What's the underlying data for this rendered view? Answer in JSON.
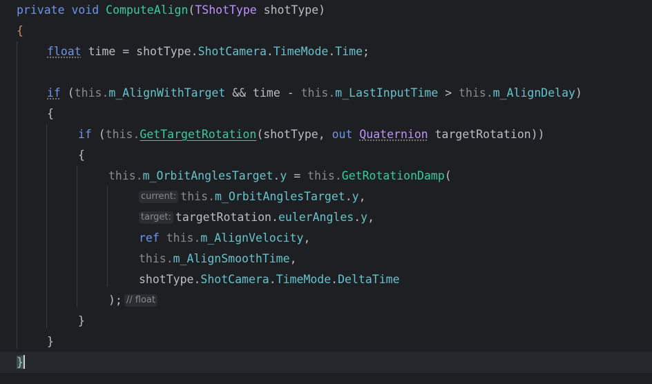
{
  "code": {
    "l1": {
      "kw1": "private",
      "kw2": "void",
      "name": "ComputeAlign",
      "p1": "(",
      "type": "TShotType",
      "p2": " shotType)"
    },
    "l2": {
      "brace": "{"
    },
    "l3": {
      "type": "float",
      "rest1": " time = shotType.",
      "m1": "ShotCamera",
      "d1": ".",
      "m2": "TimeMode",
      "d2": ".",
      "m3": "Time",
      "end": ";"
    },
    "l5": {
      "kw": "if",
      "p1": " (",
      "this1": "this.",
      "m1": "m_AlignWithTarget",
      "mid": " && time - ",
      "this2": "this.",
      "m2": "m_LastInputTime",
      "gt": " > ",
      "this3": "this.",
      "m3": "m_AlignDelay",
      "end": ")"
    },
    "l6": {
      "brace": "{"
    },
    "l7": {
      "kw": "if",
      "p1": " (",
      "this1": "this.",
      "method": "GetTargetRotation",
      "p2": "(shotType, ",
      "out": "out",
      "sp": " ",
      "type": "Quaternion",
      "end": " targetRotation))"
    },
    "l8": {
      "brace": "{"
    },
    "l9": {
      "this1": "this.",
      "m1": "m_OrbitAnglesTarget",
      "dot": ".",
      "m2": "y",
      "eq": " = ",
      "this2": "this.",
      "method": "GetRotationDamp",
      "end": "("
    },
    "l10": {
      "hint": "current:",
      "this1": "this.",
      "m1": "m_OrbitAnglesTarget",
      "dot": ".",
      "m2": "y",
      "end": ","
    },
    "l11": {
      "hint": "target:",
      "v": "targetRotation.",
      "m1": "eulerAngles",
      "dot": ".",
      "m2": "y",
      "end": ","
    },
    "l12": {
      "kw": "ref",
      "sp": " ",
      "this1": "this.",
      "m1": "m_AlignVelocity",
      "end": ","
    },
    "l13": {
      "this1": "this.",
      "m1": "m_AlignSmoothTime",
      "end": ","
    },
    "l14": {
      "v": "shotType.",
      "m1": "ShotCamera",
      "d1": ".",
      "m2": "TimeMode",
      "d2": ".",
      "m3": "DeltaTime"
    },
    "l15": {
      "end": ");",
      "hint": "// float"
    },
    "l16": {
      "brace": "}"
    },
    "l17": {
      "brace": "}"
    },
    "l18": {
      "brace": "}"
    }
  },
  "colors": {
    "background": "#1e1f22",
    "keyword": "#6c95eb",
    "type": "#c191ff",
    "method": "#39cc9b",
    "member": "#66c3cc",
    "this": "#8a8a8a"
  }
}
